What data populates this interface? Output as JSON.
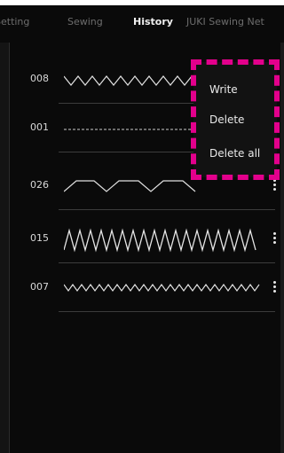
{
  "tabs": [
    {
      "label": "Setting"
    },
    {
      "label": "Sewing"
    },
    {
      "label": "History"
    },
    {
      "label": "JUKI Sewing Net"
    }
  ],
  "history": {
    "rows": [
      {
        "number": "008",
        "pattern_icon": "zigzag-small-icon"
      },
      {
        "number": "001",
        "pattern_icon": "dashed-line-icon"
      },
      {
        "number": "026",
        "pattern_icon": "blind-hem-icon"
      },
      {
        "number": "015",
        "pattern_icon": "satin-zigzag-icon"
      },
      {
        "number": "007",
        "pattern_icon": "fine-zigzag-icon"
      }
    ]
  },
  "context_menu": {
    "write": "Write",
    "delete": "Delete",
    "delete_all": "Delete all"
  },
  "colors": {
    "background": "#0a0a0a",
    "highlight": "#e3008c"
  }
}
